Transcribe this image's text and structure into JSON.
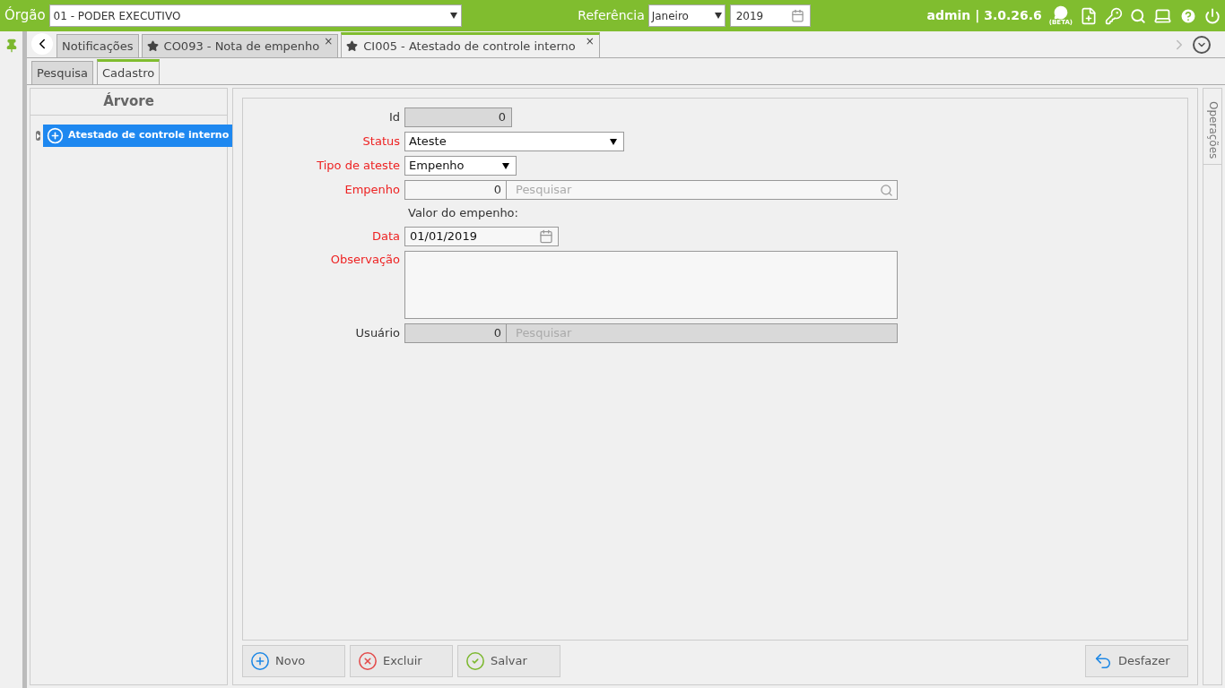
{
  "topbar": {
    "orgao_label": "Órgão",
    "orgao_value": "01 - PODER EXECUTIVO",
    "referencia_label": "Referência",
    "month": "Janeiro",
    "year": "2019",
    "user_version": "admin | 3.0.26.6",
    "beta_badge": "(BETA)"
  },
  "tabs": [
    {
      "label": "Notificações",
      "starred": false,
      "closable": false,
      "selected": false
    },
    {
      "label": "CO093 - Nota de empenho",
      "starred": true,
      "closable": true,
      "selected": false
    },
    {
      "label": "CI005 - Atestado de controle interno",
      "starred": true,
      "closable": true,
      "selected": true
    }
  ],
  "close_glyph": "×",
  "subtabs": [
    {
      "label": "Pesquisa",
      "selected": false
    },
    {
      "label": "Cadastro",
      "selected": true
    }
  ],
  "tree": {
    "title": "Árvore",
    "items": [
      {
        "label": "Atestado de controle interno",
        "selected": true
      }
    ]
  },
  "form": [
    {
      "kind": "text",
      "label": "Id",
      "required": false,
      "disabled": true,
      "value": "0"
    },
    {
      "kind": "wide_select",
      "label": "Status",
      "required": true,
      "value": "Ateste"
    },
    {
      "kind": "short_select",
      "label": "Tipo de ateste",
      "required": true,
      "value": "Empenho"
    },
    {
      "kind": "lookup",
      "label": "Empenho",
      "required": true,
      "disabled": false,
      "value": "0",
      "placeholder": "Pesquisar"
    },
    {
      "kind": "note",
      "value": "Valor do empenho:"
    },
    {
      "kind": "date",
      "label": "Data",
      "required": true,
      "value": "01/01/2019"
    },
    {
      "kind": "textarea",
      "label": "Observação",
      "required": true
    },
    {
      "kind": "lookup",
      "label": "Usuário",
      "required": false,
      "disabled": true,
      "value": "0",
      "placeholder": "Pesquisar"
    }
  ],
  "side_tab": "Operações",
  "buttons": [
    {
      "label": "Novo",
      "kind": "new"
    },
    {
      "label": "Excluir",
      "kind": "delete"
    },
    {
      "label": "Salvar",
      "kind": "save"
    },
    {
      "label": "Desfazer",
      "kind": "undo"
    }
  ]
}
